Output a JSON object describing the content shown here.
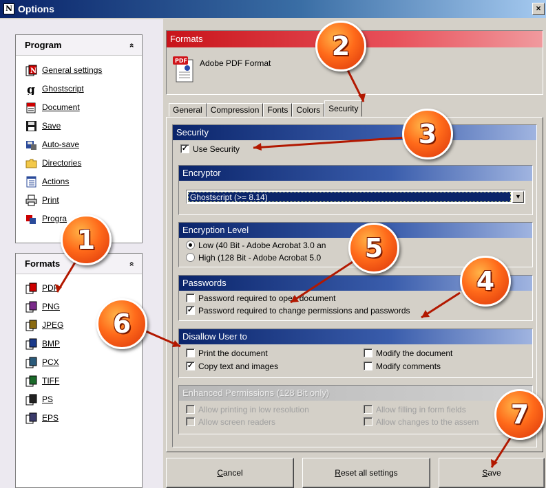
{
  "window": {
    "title": "Options",
    "close_glyph": "×"
  },
  "sidebar": {
    "program": {
      "title": "Program",
      "chevron": "»",
      "items": [
        {
          "label": "General settings",
          "icon": "general-settings-icon"
        },
        {
          "label": "Ghostscript",
          "icon": "ghostscript-icon"
        },
        {
          "label": "Document",
          "icon": "document-icon"
        },
        {
          "label": "Save",
          "icon": "floppy-disk-icon"
        },
        {
          "label": "Auto-save",
          "icon": "auto-save-icon"
        },
        {
          "label": "Directories",
          "icon": "folder-icon"
        },
        {
          "label": "Actions",
          "icon": "actions-icon"
        },
        {
          "label": "Print",
          "icon": "printer-icon"
        },
        {
          "label": "Progra",
          "icon": "program-icon"
        }
      ]
    },
    "formats": {
      "title": "Formats",
      "chevron": "»",
      "items": [
        {
          "label": "PDF",
          "icon": "pdf-format-icon"
        },
        {
          "label": "PNG",
          "icon": "png-format-icon"
        },
        {
          "label": "JPEG",
          "icon": "jpeg-format-icon"
        },
        {
          "label": "BMP",
          "icon": "bmp-format-icon"
        },
        {
          "label": "PCX",
          "icon": "pcx-format-icon"
        },
        {
          "label": "TIFF",
          "icon": "tiff-format-icon"
        },
        {
          "label": "PS",
          "icon": "ps-format-icon"
        },
        {
          "label": "EPS",
          "icon": "eps-format-icon"
        }
      ]
    }
  },
  "formats_header": {
    "title": "Formats",
    "format_name": "Adobe PDF Format",
    "icon_text": "PDF"
  },
  "tabs": [
    {
      "label": "General",
      "active": false
    },
    {
      "label": "Compression",
      "active": false
    },
    {
      "label": "Fonts",
      "active": false
    },
    {
      "label": "Colors",
      "active": false
    },
    {
      "label": "Security",
      "active": true
    }
  ],
  "security": {
    "title": "Security",
    "use_security_label": "Use Security",
    "use_security_checked": true
  },
  "encryptor": {
    "title": "Encryptor",
    "selected": "Ghostscript (>= 8.14)",
    "arrow": "▼"
  },
  "encryption_level": {
    "title": "Encryption Level",
    "options": [
      {
        "label": "Low (40 Bit - Adobe Acrobat 3.0 an",
        "selected": true
      },
      {
        "label": "High (128 Bit - Adobe Acrobat 5.0",
        "selected": false
      }
    ]
  },
  "passwords": {
    "title": "Passwords",
    "items": [
      {
        "label": "Password required to open document",
        "checked": false
      },
      {
        "label": "Password required to change permissions and passwords",
        "checked": true
      }
    ]
  },
  "disallow": {
    "title": "Disallow User to",
    "items": [
      {
        "label": "Print the document",
        "checked": false
      },
      {
        "label": "Modify the document",
        "checked": false
      },
      {
        "label": "Copy text and images",
        "checked": true
      },
      {
        "label": "Modify comments",
        "checked": false
      }
    ]
  },
  "enhanced": {
    "title": "Enhanced Permissions (128 Bit only)",
    "items": [
      {
        "label": "Allow printing in low resolution",
        "checked": false
      },
      {
        "label": "Allow filling in form fields",
        "checked": false
      },
      {
        "label": "Allow screen readers",
        "checked": false
      },
      {
        "label": "Allow changes to the assem",
        "checked": false
      }
    ]
  },
  "buttons": {
    "cancel": {
      "u": "C",
      "rest": "ancel"
    },
    "reset": {
      "u": "R",
      "rest": "eset all settings"
    },
    "save": {
      "u": "S",
      "rest": "ave"
    }
  },
  "check_glyph": "✓",
  "callouts": [
    "1",
    "2",
    "3",
    "4",
    "5",
    "6",
    "7"
  ],
  "colors": {
    "callout": "#ff6a1a",
    "section_blue": "#0a246a",
    "formats_red": "#c8141a"
  }
}
